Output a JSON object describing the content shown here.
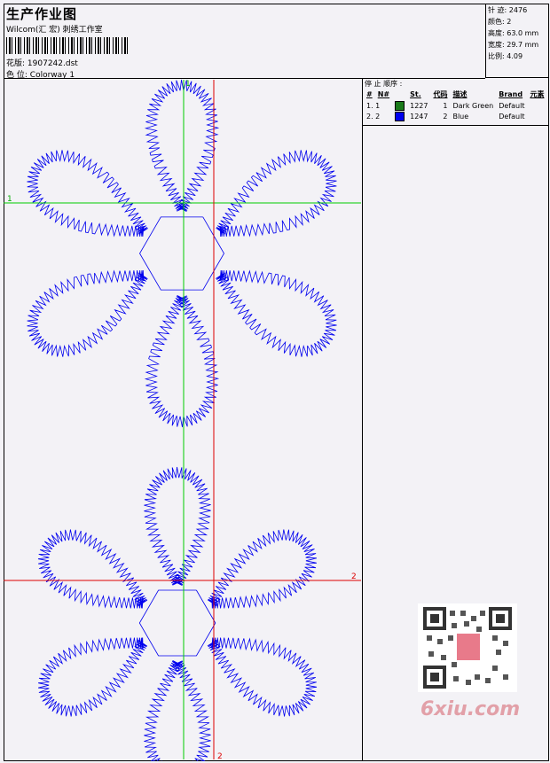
{
  "header": {
    "title": "生产作业图",
    "company": "Wilcom(汇 宏) 刺绣工作室",
    "design_label": "花版:",
    "design_value": "1907242.dst",
    "colorway_label": "色 位:",
    "colorway_value": "Colorway 1"
  },
  "stats": [
    {
      "label": "针 迹:",
      "value": "2476"
    },
    {
      "label": "颜色:",
      "value": "2"
    },
    {
      "label": "高度:",
      "value": "63.0 mm"
    },
    {
      "label": "宽度:",
      "value": "29.7 mm"
    },
    {
      "label": "比例:",
      "value": "4.09"
    }
  ],
  "stop_sequence": {
    "title": "停 止 顺序 :",
    "headers": [
      "#",
      "N#",
      "St.",
      "代码",
      "描述",
      "Brand",
      "元素"
    ],
    "rows": [
      {
        "num": "1. 1",
        "color": "#1a7a1a",
        "st": "1227",
        "code": "1",
        "desc": "Dark Green",
        "brand": "Default"
      },
      {
        "num": "2. 2",
        "color": "#0000ee",
        "st": "1247",
        "code": "2",
        "desc": "Blue",
        "brand": "Default"
      }
    ]
  },
  "markers": {
    "mark1_left": "1",
    "mark1_top": "1",
    "mark2_right": "2",
    "mark2_bottom": "2"
  },
  "watermark": {
    "site": "6xiu.com"
  },
  "colors": {
    "stitch": "#0000ee",
    "guide_green": "#00cc00",
    "guide_red": "#dd0000"
  }
}
